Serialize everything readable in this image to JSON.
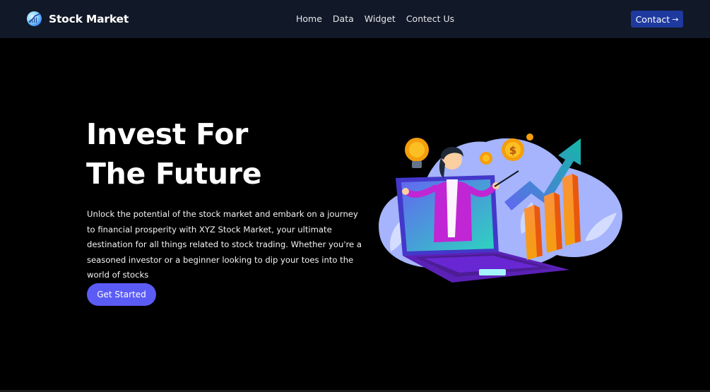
{
  "brand": {
    "name": "Stock Market",
    "logo_icon": "globe-logo-icon"
  },
  "nav": {
    "links": [
      {
        "label": "Home"
      },
      {
        "label": "Data"
      },
      {
        "label": "Widget"
      },
      {
        "label": "Contect Us"
      }
    ],
    "contact_label": "Contact",
    "contact_icon": "arrow-right-icon"
  },
  "hero": {
    "title_line1": "Invest For",
    "title_line2": "The Future",
    "description": "Unlock the potential of the stock market and embark on a journey to financial prosperity with XYZ Stock Market, your ultimate destination for all things related to stock trading. Whether you're a seasoned investor or a beginner looking to dip your toes into the world of stocks",
    "cta_label": "Get Started",
    "illustration_icon": "investor-laptop-chart-illustration"
  },
  "colors": {
    "nav_bg": "#111827",
    "page_bg": "#000000",
    "contact_button": "#1e3a9e",
    "cta_button": "#5b5cf6"
  }
}
